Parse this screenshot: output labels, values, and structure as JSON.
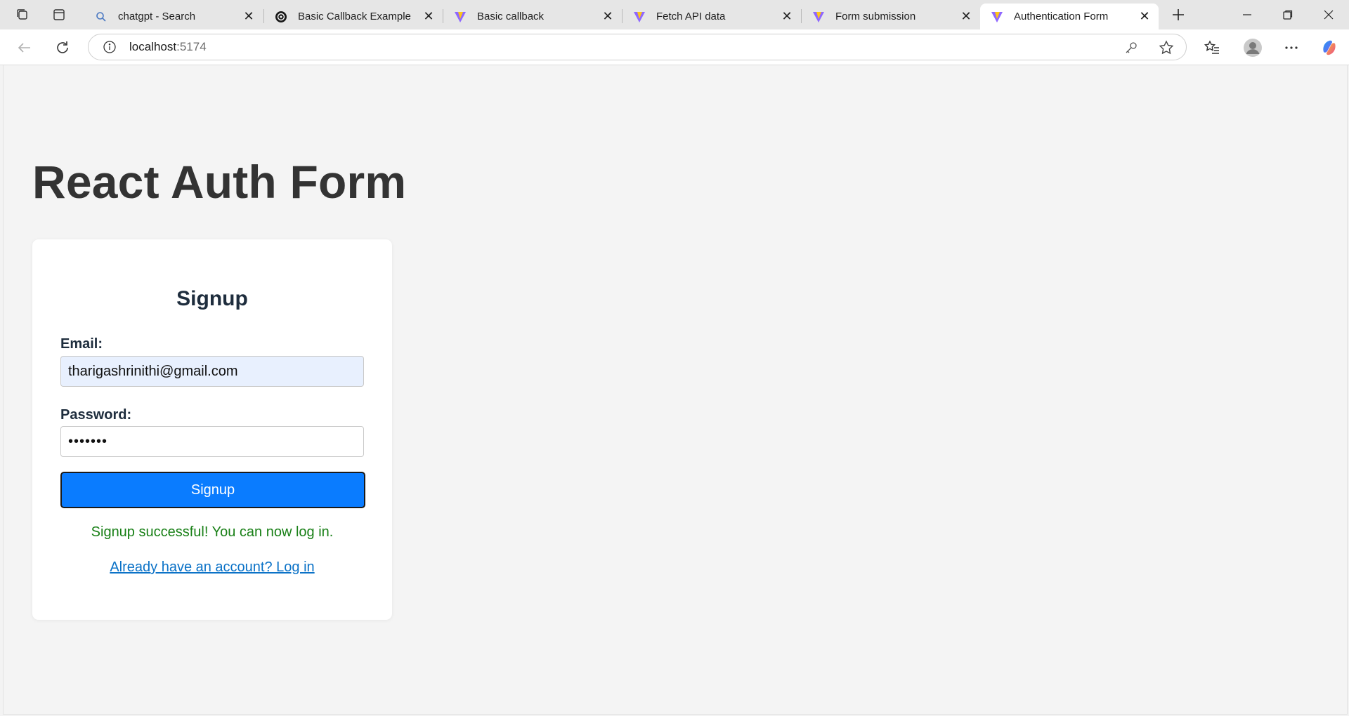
{
  "browser": {
    "tabs": [
      {
        "title": "chatgpt - Search",
        "icon": "search-icon"
      },
      {
        "title": "Basic Callback Example",
        "icon": "openai-icon"
      },
      {
        "title": "Basic callback",
        "icon": "vite-icon"
      },
      {
        "title": "Fetch API data",
        "icon": "vite-icon"
      },
      {
        "title": "Form submission",
        "icon": "vite-icon"
      },
      {
        "title": "Authentication Form",
        "icon": "vite-icon",
        "active": true
      }
    ],
    "address": {
      "host": "localhost",
      "port": ":5174"
    }
  },
  "page": {
    "heading": "React Auth Form",
    "form": {
      "title": "Signup",
      "email_label": "Email:",
      "email_value": "tharigashrinithi@gmail.com",
      "password_label": "Password:",
      "password_value": "1234567",
      "submit_label": "Signup",
      "message": "Signup successful! You can now log in.",
      "toggle_link": "Already have an account? Log in"
    }
  },
  "colors": {
    "button": "#0a7cff",
    "success": "#198017",
    "link": "#0b72c7",
    "autofill": "#e8f0fe"
  }
}
